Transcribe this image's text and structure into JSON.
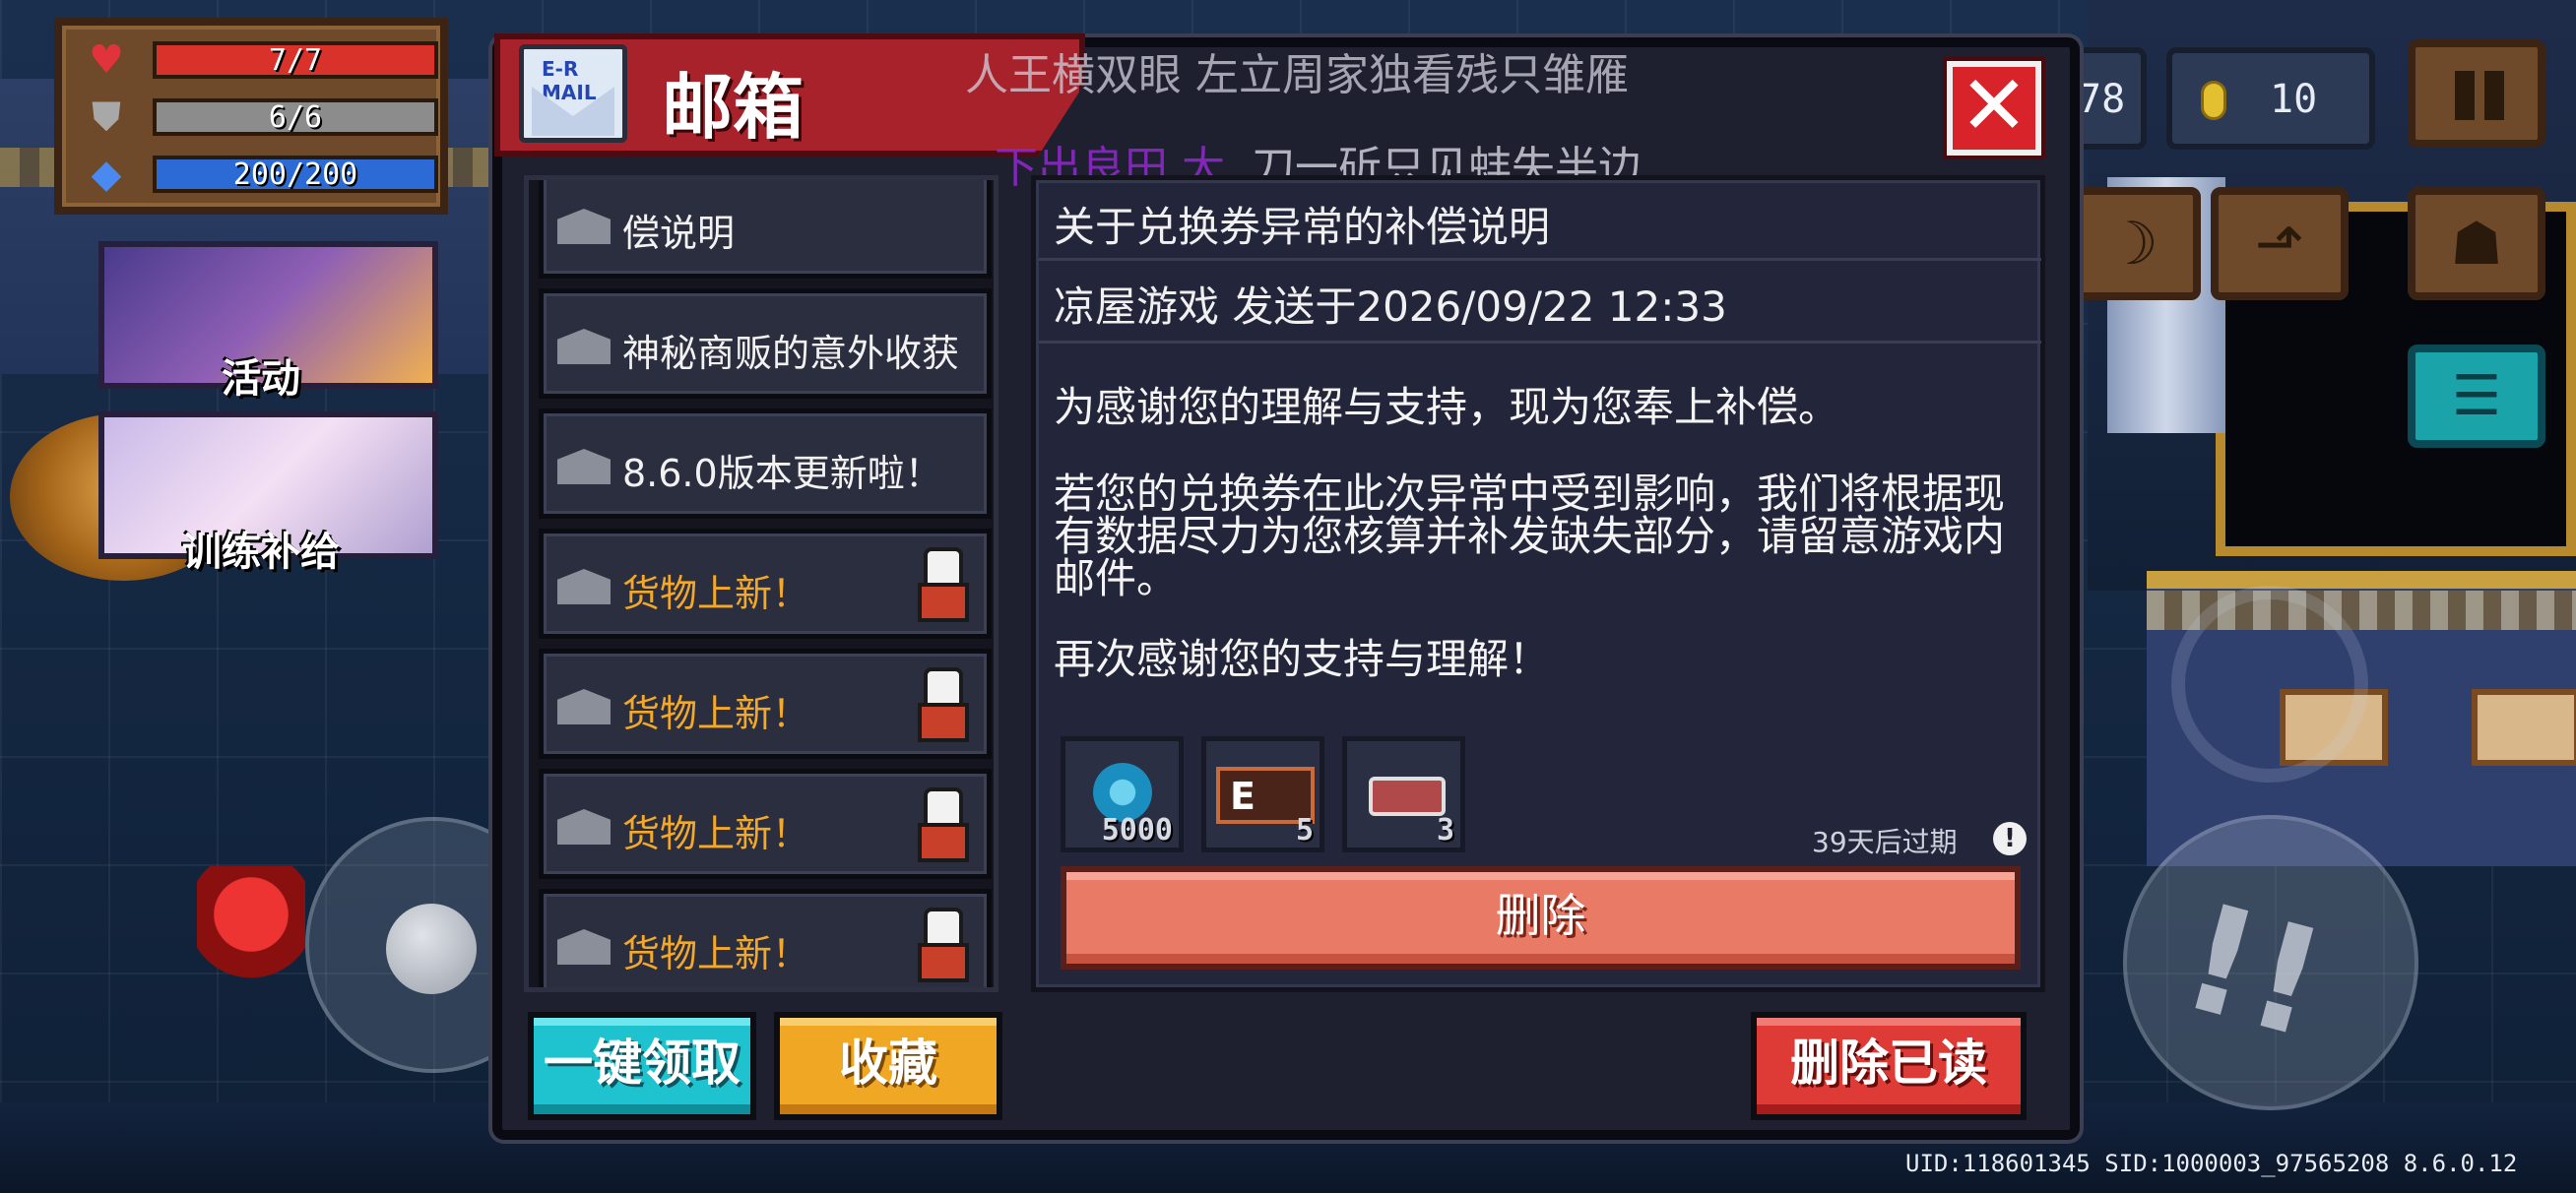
{
  "hud": {
    "hp": "7/7",
    "armor": "6/6",
    "energy": "200/200",
    "activity_label": "活动",
    "training_label": "训练补给",
    "gem_count": "78",
    "coin_count": "10",
    "uid_line": "UID:118601345 SID:1000003_97565208 8.6.0.12"
  },
  "danmaku": {
    "line1": "人王横双眼 左立周家独看残只雏雁",
    "line2_purple": "下出良田 大",
    "line2_white": "刀一斫只见蚌失半边"
  },
  "mailbox": {
    "title": "邮箱",
    "icon_label": "E-R MAIL",
    "close_symbol": "✕",
    "items": [
      {
        "label": "偿说明",
        "style": "normal"
      },
      {
        "label": "神秘商贩的意外收获",
        "style": "normal"
      },
      {
        "label": "8.6.0版本更新啦！",
        "style": "normal"
      },
      {
        "label": "货物上新！",
        "style": "gold"
      },
      {
        "label": "货物上新！",
        "style": "gold"
      },
      {
        "label": "货物上新！",
        "style": "gold"
      },
      {
        "label": "货物上新！",
        "style": "gold"
      }
    ],
    "detail": {
      "title": "关于兑换券异常的补偿说明",
      "sender_line": "凉屋游戏 发送于2026/09/22 12:33",
      "para1": "为感谢您的理解与支持，现为您奉上补偿。",
      "para2": "若您的兑换券在此次异常中受到影响，我们将根据现有数据尽力为您核算并补发缺失部分，请留意游戏内邮件。",
      "para3": "再次感谢您的支持与理解！",
      "rewards": [
        {
          "icon": "blue-gem-coin-icon",
          "qty": "5000"
        },
        {
          "icon": "voucher-ticket-icon",
          "qty": "5",
          "glyph": "E"
        },
        {
          "icon": "ticket-stub-icon",
          "qty": "3"
        }
      ],
      "expire": "39天后过期",
      "warn_symbol": "!",
      "delete_label": "删除"
    },
    "buttons": {
      "claim_all": "一键领取",
      "favorite": "收藏",
      "delete_read": "删除已读"
    }
  },
  "colors": {
    "title_red": "#a8222c",
    "claim_cyan": "#1fc3d0",
    "favorite_gold": "#f0a824",
    "delete_read_red": "#de3a36",
    "delete_salmon": "#e87a66",
    "gold_text": "#f2a82a"
  }
}
